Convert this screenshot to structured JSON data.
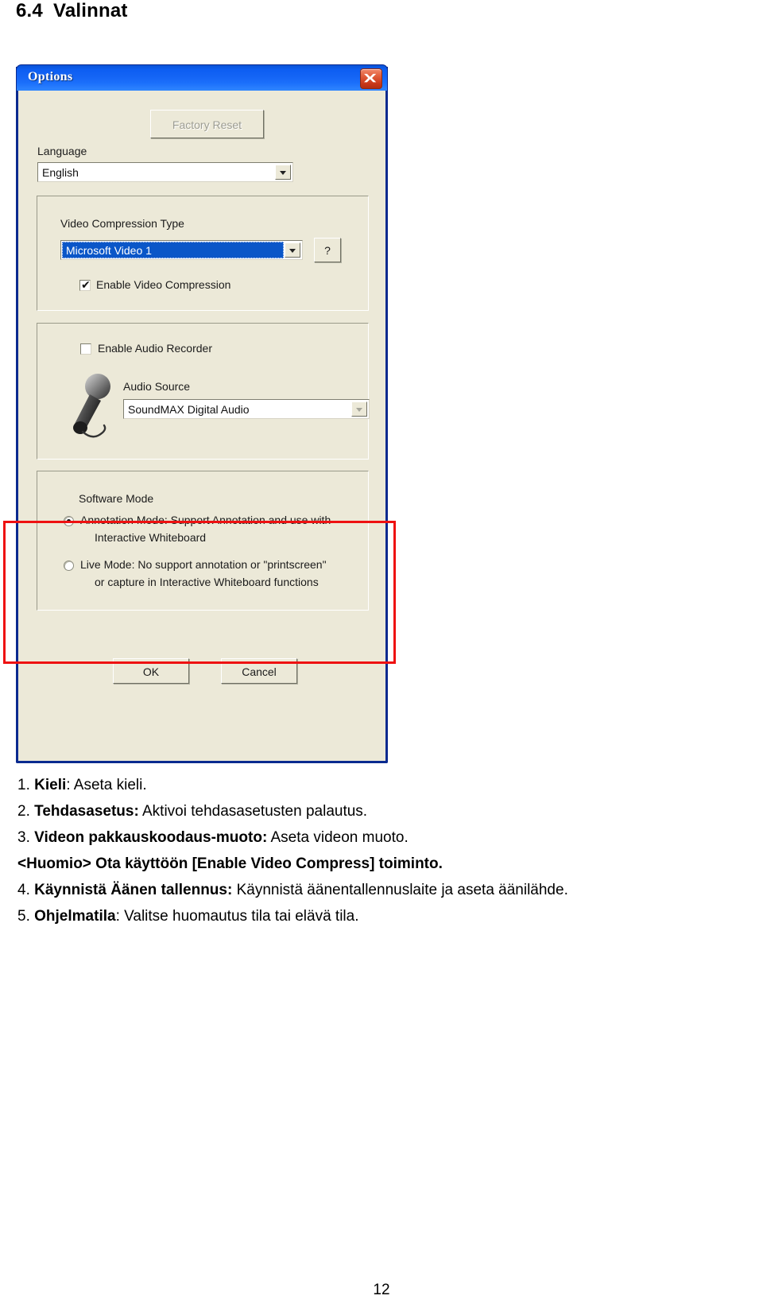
{
  "document": {
    "heading_number": "6.4",
    "heading_title": "Valinnat",
    "page_number": "12"
  },
  "dialog": {
    "title": "Options",
    "close_icon": "close-x-icon",
    "factory_reset_label": "Factory Reset",
    "language_label": "Language",
    "language_value": "English",
    "video": {
      "group_label": "Video Compression Type",
      "codec_value": "Microsoft Video 1",
      "help_button_label": "?",
      "enable_checkbox_label": "Enable Video Compression",
      "enable_checkbox_checked": true,
      "check_glyph": "✔"
    },
    "audio": {
      "enable_checkbox_label": "Enable Audio Recorder",
      "enable_checkbox_checked": false,
      "source_label": "Audio Source",
      "source_value": "SoundMAX Digital Audio",
      "mic_icon": "microphone-icon"
    },
    "software_mode": {
      "group_label": "Software Mode",
      "options": [
        {
          "line1": "Annotation Mode: Support Annotation and use with",
          "line2": "Interactive Whiteboard",
          "selected": true
        },
        {
          "line1": "Live Mode: No support annotation or \"printscreen\"",
          "line2": "or capture in Interactive Whiteboard functions",
          "selected": false
        }
      ]
    },
    "ok_label": "OK",
    "cancel_label": "Cancel"
  },
  "annotation": {
    "highlight_color": "#ee1111"
  },
  "instructions": [
    {
      "index": "1.",
      "term": "Kieli",
      "separator": ":",
      "text": " Aseta kieli."
    },
    {
      "index": "2.",
      "term": "Tehdasasetus:",
      "separator": "",
      "text": " Aktivoi tehdasasetusten palautus."
    },
    {
      "index": "3.",
      "term": "Videon pakkauskoodaus-muoto:",
      "separator": "",
      "text": " Aseta videon muoto."
    },
    {
      "index": "",
      "term": "<Huomio> Ota käyttöön [Enable Video Compress] toiminto.",
      "separator": "",
      "text": ""
    },
    {
      "index": "4.",
      "term": "Käynnistä Äänen tallennus:",
      "separator": "",
      "text": " Käynnistä äänentallennuslaite ja aseta äänilähde."
    },
    {
      "index": "5.",
      "term": "Ohjelmatila",
      "separator": ":",
      "text": " Valitse huomautus tila tai elävä tila."
    }
  ],
  "colors": {
    "titlebar_blue": "#1464f5",
    "dialog_face": "#ece9d8",
    "dialog_border": "#0a2a8f",
    "selection_blue": "#0a56c8",
    "highlight_red": "#ee1111"
  }
}
